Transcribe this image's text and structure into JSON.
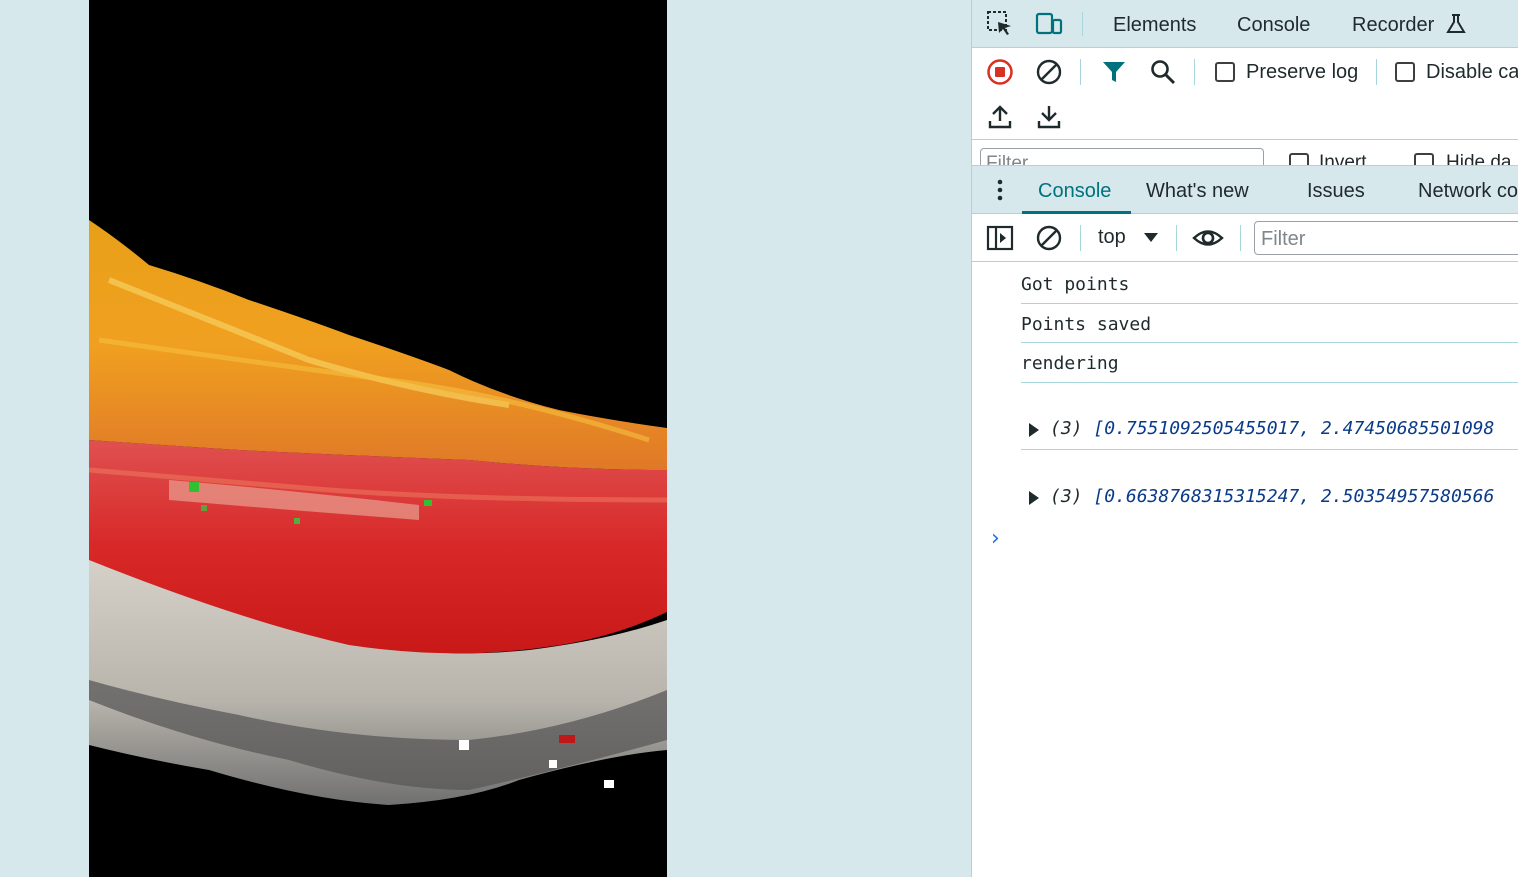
{
  "colors": {
    "page_bg": "#d6e8ec",
    "accent": "#00727e",
    "record_red": "#d93025",
    "border": "#a8d6dd"
  },
  "viewport": {
    "description_icon": "point-cloud-render"
  },
  "devtools": {
    "top_tabs": {
      "inspect_icon": "inspect-element-icon",
      "device_icon": "device-toolbar-icon",
      "elements": "Elements",
      "console": "Console",
      "recorder": "Recorder",
      "recorder_icon": "flask-icon"
    },
    "network_toolbar": {
      "record_icon": "record-stop-icon",
      "clear_icon": "clear-icon",
      "filter_icon": "filter-icon",
      "search_icon": "search-icon",
      "preserve_log": "Preserve log",
      "disable_cache": "Disable ca",
      "upload_icon": "upload-icon",
      "download_icon": "download-icon"
    },
    "network_filter": {
      "placeholder": "Filter",
      "invert": "Invert",
      "hide_data": "Hide da"
    },
    "drawer_tabs": {
      "menu_icon": "more-vertical-icon",
      "console": "Console",
      "whats_new": "What's new",
      "issues": "Issues",
      "network_conditions": "Network co"
    },
    "console_toolbar": {
      "sidebar_icon": "sidebar-toggle-icon",
      "clear_icon": "clear-icon",
      "context": "top",
      "eye_icon": "live-expression-icon",
      "filter_placeholder": "Filter"
    },
    "console_messages": [
      "Got points",
      "Points saved",
      "rendering"
    ],
    "console_arrays": [
      {
        "count": "(3)",
        "values": "[0.7551092505455017, 2.47450685501098"
      },
      {
        "count": "(3)",
        "values": "[0.6638768315315247, 2.50354957580566"
      }
    ],
    "prompt": "›"
  }
}
